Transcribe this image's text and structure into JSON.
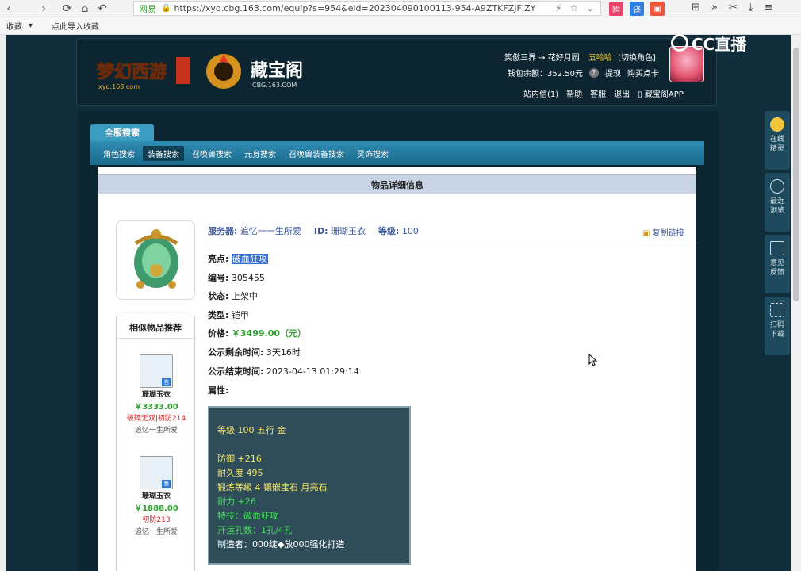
{
  "browser": {
    "bookmark_items": [
      "收藏",
      "点此导入收藏"
    ],
    "security_label": "网易",
    "url": "https://xyq.cbg.163.com/equip?s=954&eid=202304090100113-954-A9ZTKFZJFIZY"
  },
  "overlay": {
    "cc_logo": "CC直播"
  },
  "header": {
    "game_logo_text": "梦幻西游",
    "cbg_title": "藏宝阁",
    "cbg_domain": "CBG.163.COM",
    "server_path": "笑傲三界 → 花好月圆",
    "username": "五哈哈",
    "switch_role": "[切换角色]",
    "wallet_label": "钱包余额：352.50元",
    "withdraw": "提现",
    "buy_card": "购买点卡",
    "links": [
      "站内信(1)",
      "帮助",
      "客服",
      "退出",
      "藏宝阁APP"
    ]
  },
  "side_widgets": [
    {
      "label": "在线精灵",
      "icon": "sprite-icon"
    },
    {
      "label": "最近浏览",
      "icon": "clock-icon"
    },
    {
      "label": "意见反馈",
      "icon": "edit-icon"
    },
    {
      "label": "扫码下载",
      "icon": "scan-icon"
    }
  ],
  "search": {
    "main_tab": "全服搜索",
    "sub_tabs": [
      "角色搜索",
      "装备搜索",
      "召唤兽搜索",
      "元身搜索",
      "召唤兽装备搜索",
      "灵饰搜索"
    ],
    "active_sub_tab": "装备搜索"
  },
  "detail": {
    "section_title": "物品详细信息",
    "server_label": "服务器:",
    "server_value": "追忆一一生所爱",
    "id_label": "ID:",
    "id_value": "珊瑚玉衣",
    "level_label": "等级:",
    "level_value": "100",
    "copy_link": "复制链接",
    "highlight_label": "亮点:",
    "highlight_value": "破血狂攻",
    "number_label": "编号:",
    "number_value": "305455",
    "status_label": "状态:",
    "status_value": "上架中",
    "type_label": "类型:",
    "type_value": "铠甲",
    "price_label": "价格:",
    "price_value": "￥3499.00（元）",
    "remain_label": "公示剩余时间:",
    "remain_value": "3天16时",
    "end_label": "公示结束时间:",
    "end_value": "2023-04-13 01:29:14",
    "attr_label": "属性:"
  },
  "attributes": [
    {
      "text": "等级 100 五行 金",
      "color": "yellow"
    },
    {
      "text": "",
      "color": "yellow"
    },
    {
      "text": "防御 +216",
      "color": "yellow"
    },
    {
      "text": "耐久度 495",
      "color": "yellow"
    },
    {
      "text": "锻炼等级 4 镶嵌宝石 月亮石",
      "color": "yellow"
    },
    {
      "text": "耐力 +26",
      "color": "green"
    },
    {
      "text": "特技：破血狂攻",
      "color": "green"
    },
    {
      "text": "开运孔数：1孔/4孔",
      "color": "green"
    },
    {
      "text": "制造者：000绽◆放000强化打造",
      "color": "white"
    }
  ],
  "similar": {
    "title": "相似物品推荐",
    "items": [
      {
        "name": "珊瑚玉衣",
        "price": "￥3333.00",
        "attr": "破碎无双|初防214",
        "server": "追忆一生所爱",
        "badge": "售"
      },
      {
        "name": "珊瑚玉衣",
        "price": "￥1888.00",
        "attr": "初防213",
        "server": "追忆一生所爱",
        "badge": "售"
      }
    ]
  }
}
